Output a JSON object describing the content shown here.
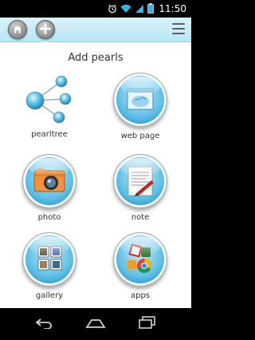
{
  "status_bar": {
    "time": "11:50",
    "icons": [
      "alarm-icon",
      "wifi-icon",
      "signal-icon",
      "battery-icon"
    ]
  },
  "app_bar": {
    "home_icon": "home-icon",
    "add_icon": "plus-icon",
    "add_label": "add",
    "menu_icon": "menu-icon",
    "color": "#c6ecf8"
  },
  "main": {
    "title": "Add pearls",
    "tiles": [
      {
        "label": "pearltree",
        "icon": "pearltree-icon"
      },
      {
        "label": "web page",
        "icon": "web-page-icon"
      },
      {
        "label": "photo",
        "icon": "camera-icon"
      },
      {
        "label": "note",
        "icon": "note-icon"
      },
      {
        "label": "gallery",
        "icon": "gallery-icon"
      },
      {
        "label": "apps",
        "icon": "apps-icon"
      }
    ]
  },
  "nav_bar": {
    "icons": [
      "back-icon",
      "home-nav-icon",
      "recents-icon"
    ]
  }
}
